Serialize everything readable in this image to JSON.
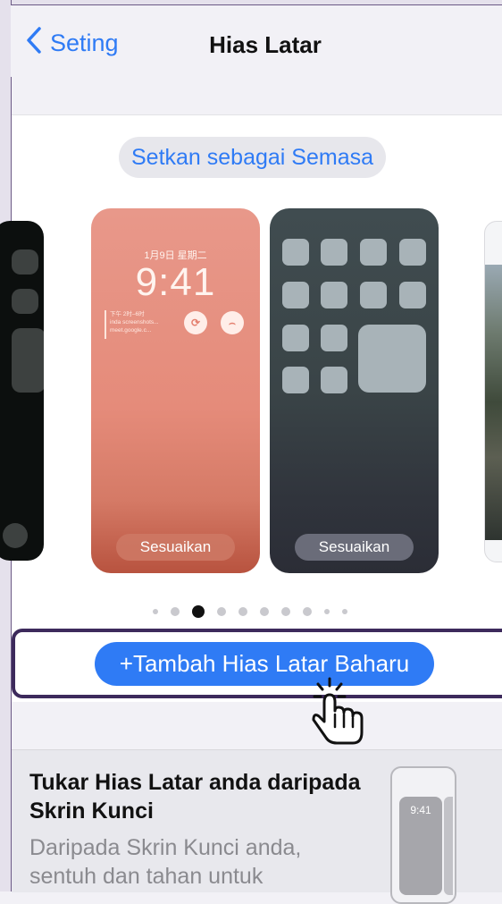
{
  "nav": {
    "back_label": "Seting",
    "title": "Hias Latar"
  },
  "wallpaper": {
    "set_current_label": "Setkan sebagai Semasa",
    "lock": {
      "date": "1月9日 星期二",
      "time": "9:41",
      "widget_line1": "下午 2时–6时",
      "widget_line2": "inda screenshots...",
      "widget_line3": "meet.google.c...",
      "customize_label": "Sesuaikan"
    },
    "home": {
      "customize_label": "Sesuaikan"
    },
    "page_dots": {
      "count": 10,
      "active_index": 2
    }
  },
  "add_new": {
    "label": "+Tambah Hias Latar Baharu"
  },
  "info": {
    "title": "Tukar Hias Latar anda daripada Skrin Kunci",
    "body": "Daripada Skrin Kunci anda, sentuh dan tahan untuk",
    "preview_time": "9:41"
  },
  "colors": {
    "accent": "#2f7bf5",
    "highlight_border": "#3d2a5c"
  }
}
